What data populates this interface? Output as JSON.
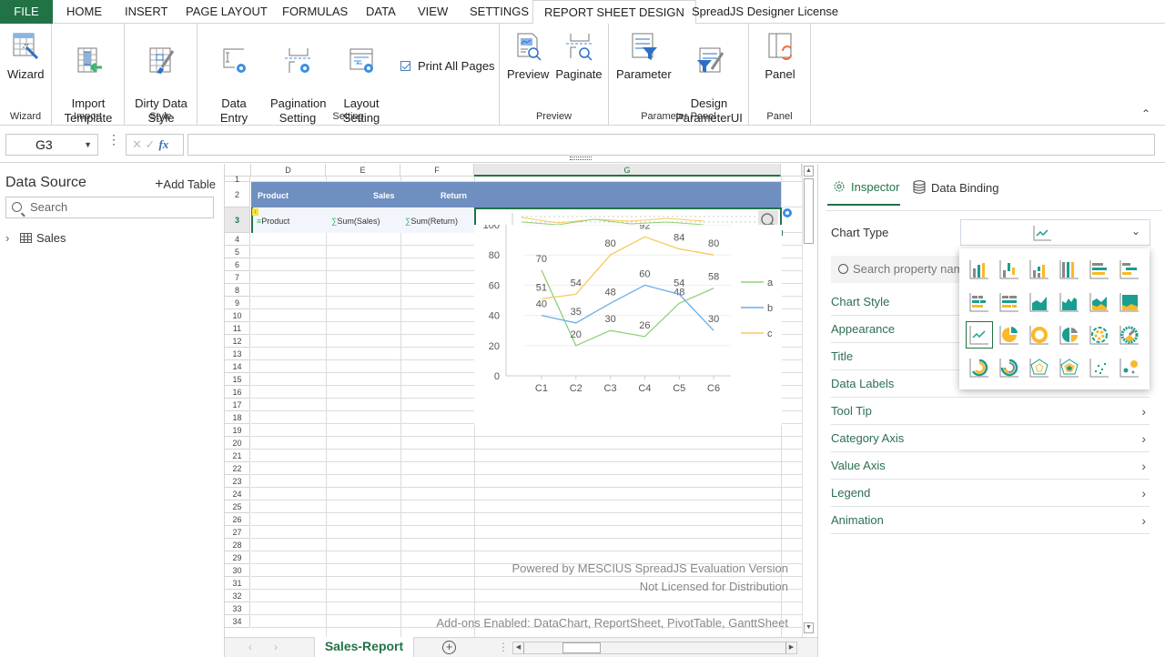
{
  "ribbon_tabs": [
    {
      "label": "FILE"
    },
    {
      "label": "HOME"
    },
    {
      "label": "INSERT"
    },
    {
      "label": "PAGE LAYOUT"
    },
    {
      "label": "FORMULAS"
    },
    {
      "label": "DATA"
    },
    {
      "label": "VIEW"
    },
    {
      "label": "SETTINGS"
    },
    {
      "label": "REPORT SHEET DESIGN"
    },
    {
      "label": "SpreadJS Designer License"
    }
  ],
  "active_tab": "REPORT SHEET DESIGN",
  "ribbon": {
    "groups": [
      {
        "label": "Wizard",
        "buttons": [
          {
            "label": "Wizard",
            "icon": "wizard-icon"
          }
        ]
      },
      {
        "label": "Import",
        "buttons": [
          {
            "label": "Import\nTemplate",
            "icon": "import-template-icon"
          }
        ]
      },
      {
        "label": "Style",
        "buttons": [
          {
            "label": "Dirty Data\nStyle",
            "icon": "dirty-data-style-icon"
          }
        ]
      },
      {
        "label": "Setting",
        "buttons": [
          {
            "label": "Data Entry\nSetting",
            "icon": "data-entry-setting-icon"
          },
          {
            "label": "Pagination\nSetting",
            "icon": "pagination-setting-icon"
          },
          {
            "label": "Layout\nSetting",
            "icon": "layout-setting-icon"
          }
        ],
        "checkbox": {
          "label": "Print All Pages",
          "checked": true
        }
      },
      {
        "label": "Preview",
        "buttons": [
          {
            "label": "Preview",
            "icon": "preview-icon"
          },
          {
            "label": "Paginate",
            "icon": "paginate-icon"
          }
        ]
      },
      {
        "label": "Parameter Panel",
        "buttons": [
          {
            "label": "Parameter",
            "icon": "parameter-icon"
          },
          {
            "label": "Design\nParameterUI",
            "icon": "design-parameterui-icon"
          }
        ]
      },
      {
        "label": "Panel",
        "buttons": [
          {
            "label": "Panel",
            "icon": "panel-icon"
          }
        ]
      }
    ]
  },
  "formula_bar": {
    "name_box": "G3",
    "formula": ""
  },
  "data_source": {
    "title": "Data Source",
    "add_label": "Add Table",
    "search_placeholder": "Search",
    "tree": [
      {
        "label": "Sales",
        "icon": "table-icon"
      }
    ]
  },
  "sheet": {
    "columns": [
      "D",
      "E",
      "F",
      "G"
    ],
    "rows": [
      "1",
      "2",
      "3",
      "4",
      "5",
      "6",
      "7",
      "8",
      "9",
      "10",
      "11",
      "12",
      "13",
      "14",
      "15",
      "16",
      "17",
      "18",
      "19",
      "20",
      "21",
      "22",
      "23",
      "24",
      "25",
      "26",
      "27",
      "28",
      "29",
      "30",
      "31",
      "32",
      "33",
      "34"
    ],
    "header_row": [
      "Product",
      "Sales",
      "Return"
    ],
    "template_row": [
      "Product",
      "Sum(Sales)",
      "Sum(Return)"
    ],
    "selected_cell": "G3",
    "tab": "Sales-Report",
    "watermark": [
      "Powered by MESCIUS SpreadJS Evaluation Version",
      "Not Licensed for Distribution",
      "Add-ons Enabled: DataChart, ReportSheet, PivotTable, GanttSheet"
    ],
    "colors": {
      "header_band": "#6f8fc1",
      "selection": "#217346"
    }
  },
  "chart_data": {
    "type": "line",
    "categories": [
      "C1",
      "C2",
      "C3",
      "C4",
      "C5",
      "C6"
    ],
    "series": [
      {
        "name": "a",
        "color": "#92d07a",
        "values": [
          70,
          20,
          30,
          26,
          48,
          58
        ]
      },
      {
        "name": "b",
        "color": "#6aaee8",
        "values": [
          40,
          35,
          48,
          60,
          54,
          30
        ]
      },
      {
        "name": "c",
        "color": "#f7c95a",
        "values": [
          51,
          54,
          80,
          92,
          84,
          80
        ]
      }
    ],
    "ylim": [
      0,
      100
    ],
    "yticks": [
      0,
      20,
      40,
      60,
      80,
      100
    ],
    "title": "",
    "xlabel": "",
    "ylabel": "",
    "grid": true,
    "data_labels": true,
    "legend": "right"
  },
  "inspector": {
    "tabs": [
      {
        "label": "Inspector",
        "icon": "gear-icon"
      },
      {
        "label": "Data Binding",
        "icon": "database-icon"
      }
    ],
    "chart_type_label": "Chart Type",
    "chart_type_value": "line",
    "search_placeholder": "Search property name",
    "properties": [
      {
        "label": "Chart Style"
      },
      {
        "label": "Appearance"
      },
      {
        "label": "Title"
      },
      {
        "label": "Data Labels"
      },
      {
        "label": "Tool Tip"
      },
      {
        "label": "Category Axis"
      },
      {
        "label": "Value Axis"
      },
      {
        "label": "Legend"
      },
      {
        "label": "Animation"
      }
    ],
    "chart_types": [
      "column-clustered",
      "column-stacked",
      "column-percent",
      "column-stacked-100",
      "bar-clustered",
      "bar-stacked",
      "bar-stacked-2",
      "bar-percent",
      "area",
      "area-stacked",
      "area-percent",
      "area-stacked-100",
      "line",
      "pie",
      "donut",
      "pie-exploded",
      "sunburst",
      "sunburst-2",
      "radial",
      "radial-2",
      "radar",
      "radar-filled",
      "scatter",
      "bubble"
    ],
    "selected_chart_type": "line",
    "colors": {
      "accent": "#217346",
      "teal": "#1a9e8f",
      "orange": "#fbb829",
      "gray": "#888888"
    }
  }
}
